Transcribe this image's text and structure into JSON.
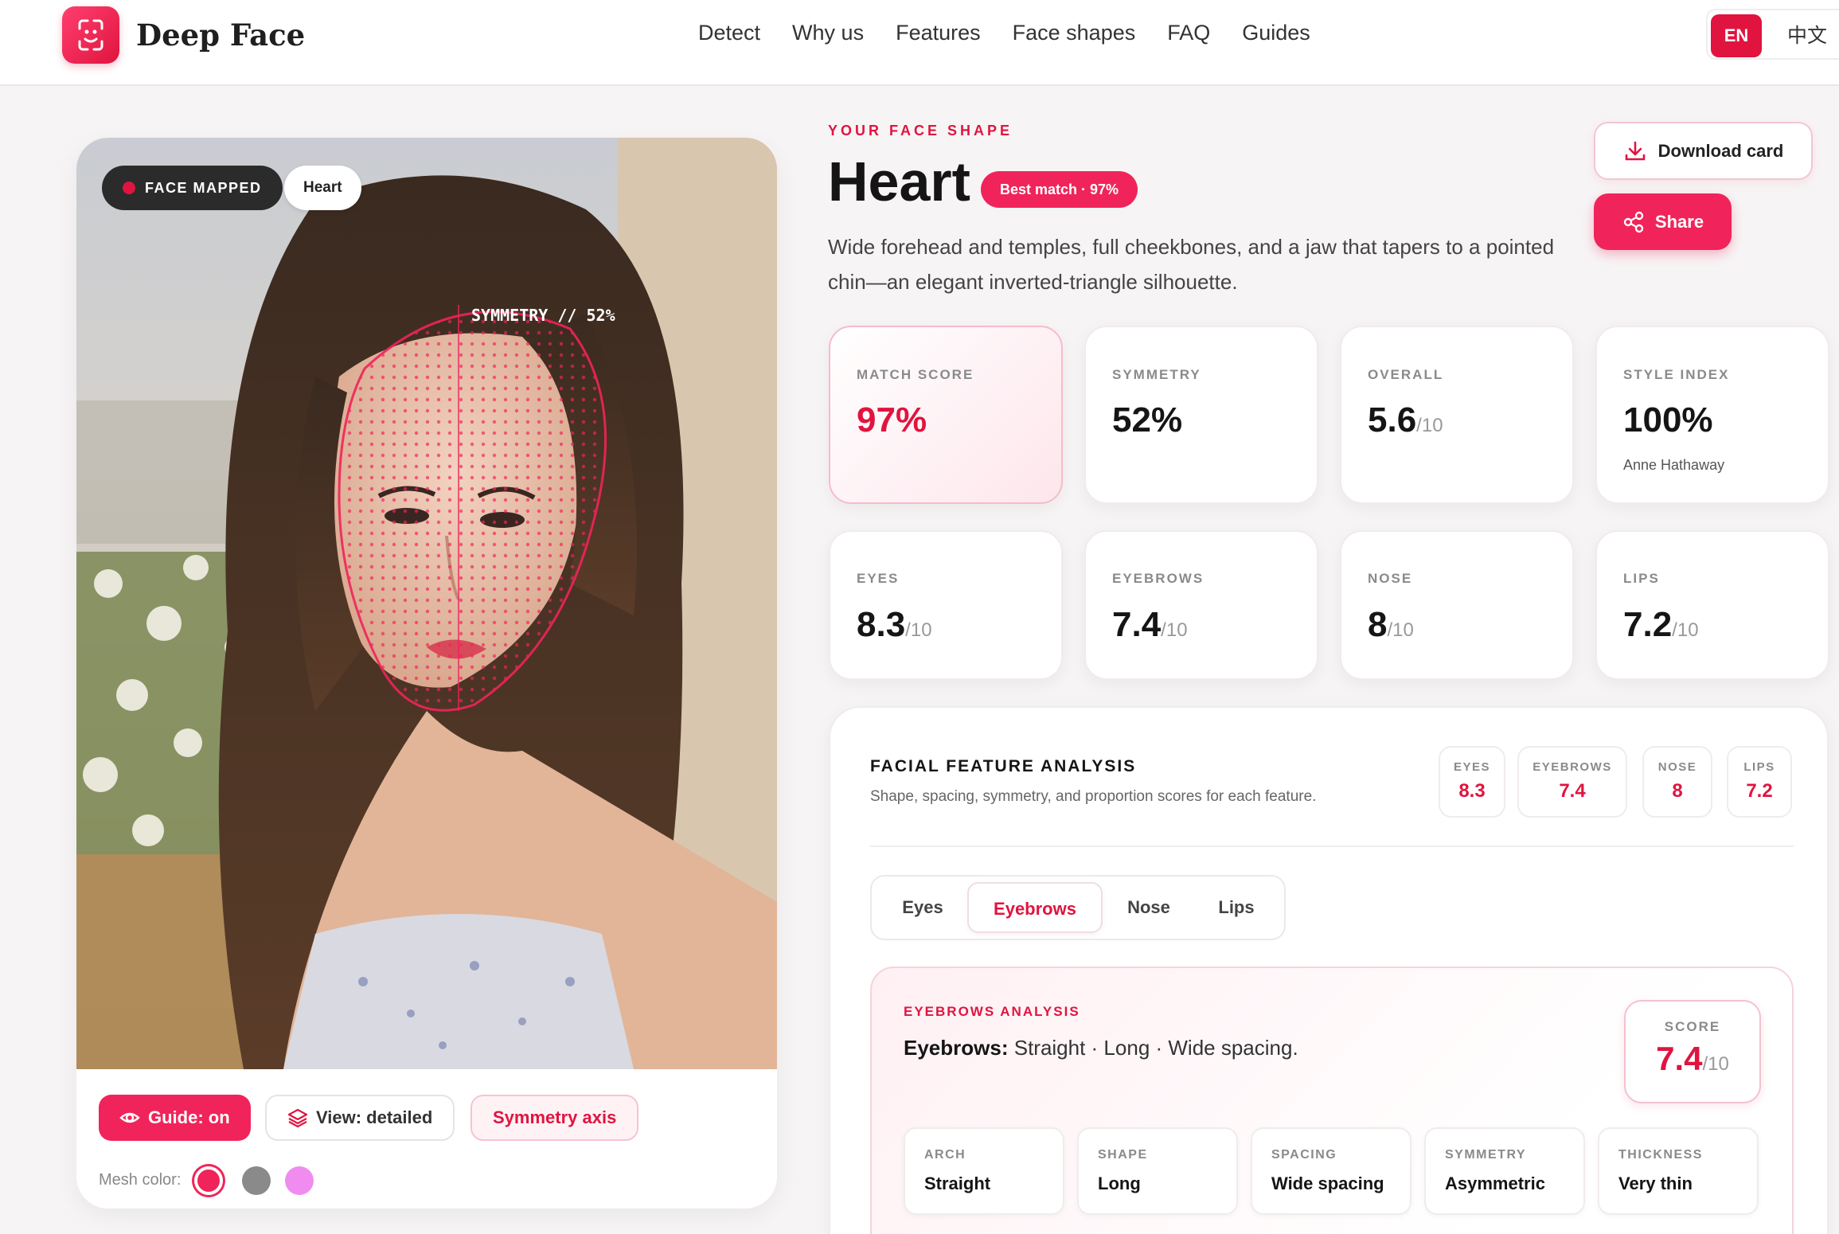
{
  "header": {
    "brand": "Deep Face",
    "nav": [
      "Detect",
      "Why us",
      "Features",
      "Face shapes",
      "FAQ",
      "Guides"
    ],
    "lang_en": "EN",
    "lang_zh": "中文"
  },
  "photo": {
    "chip_status": "FACE MAPPED",
    "chip_shape": "Heart",
    "overlay_text": "SYMMETRY // 52%",
    "guide_btn": "Guide: on",
    "view_btn": "View: detailed",
    "symmetry_btn": "Symmetry axis",
    "mesh_label": "Mesh color:",
    "mesh_colors": [
      "#f0245a",
      "#8a8a8a",
      "#f08cf0"
    ]
  },
  "result": {
    "eyebrow": "YOUR FACE SHAPE",
    "shape": "Heart",
    "badge": "Best match · 97%",
    "description": "Wide forehead and temples, full cheekbones, and a jaw that tapers to a pointed chin—an elegant inverted-triangle silhouette.",
    "download_label": "Download card",
    "share_label": "Share"
  },
  "stats": [
    {
      "label": "MATCH SCORE",
      "value": "97%",
      "suffix": ""
    },
    {
      "label": "SYMMETRY",
      "value": "52%",
      "suffix": ""
    },
    {
      "label": "OVERALL",
      "value": "5.6",
      "suffix": "/10"
    },
    {
      "label": "STYLE INDEX",
      "value": "100%",
      "suffix": "",
      "sub": "Anne Hathaway"
    },
    {
      "label": "EYES",
      "value": "8.3",
      "suffix": "/10"
    },
    {
      "label": "EYEBROWS",
      "value": "7.4",
      "suffix": "/10"
    },
    {
      "label": "NOSE",
      "value": "8",
      "suffix": "/10"
    },
    {
      "label": "LIPS",
      "value": "7.2",
      "suffix": "/10"
    }
  ],
  "analysis": {
    "title": "FACIAL FEATURE ANALYSIS",
    "subtitle": "Shape, spacing, symmetry, and proportion scores for each feature.",
    "mini": [
      {
        "label": "EYES",
        "value": "8.3"
      },
      {
        "label": "EYEBROWS",
        "value": "7.4"
      },
      {
        "label": "NOSE",
        "value": "8"
      },
      {
        "label": "LIPS",
        "value": "7.2"
      }
    ],
    "tabs": [
      "Eyes",
      "Eyebrows",
      "Nose",
      "Lips"
    ],
    "active_tab": "Eyebrows",
    "detail": {
      "eyebrow": "EYEBROWS ANALYSIS",
      "lead": "Eyebrows:",
      "text": " Straight · Long · Wide spacing.",
      "score_label": "SCORE",
      "score_value": "7.4",
      "score_suffix": "/10",
      "attributes": [
        {
          "label": "ARCH",
          "value": "Straight"
        },
        {
          "label": "SHAPE",
          "value": "Long"
        },
        {
          "label": "SPACING",
          "value": "Wide spacing"
        },
        {
          "label": "SYMMETRY",
          "value": "Asymmetric"
        },
        {
          "label": "THICKNESS",
          "value": "Very thin"
        }
      ]
    }
  },
  "colors": {
    "accent": "#e0143f",
    "accent_bright": "#f0245a"
  }
}
